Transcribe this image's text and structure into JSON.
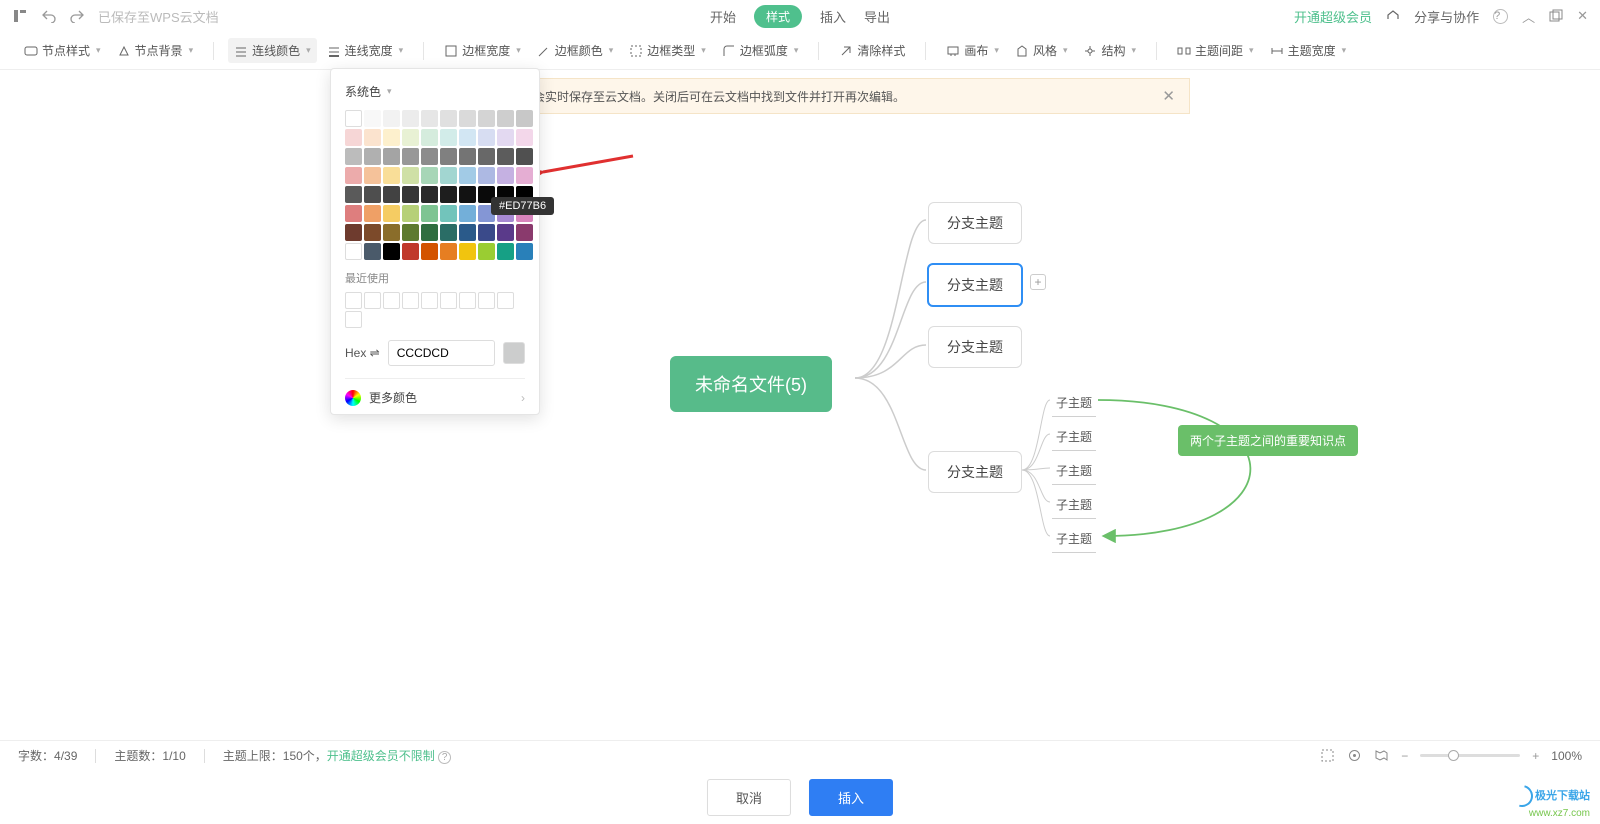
{
  "topbar": {
    "save_status": "已保存至WPS云文档",
    "tabs": {
      "start": "开始",
      "style": "样式",
      "insert": "插入",
      "export": "导出"
    },
    "vip": "开通超级会员",
    "share": "分享与协作"
  },
  "toolbar": {
    "node_style": "节点样式",
    "node_bg": "节点背景",
    "line_color": "连线颜色",
    "line_width": "连线宽度",
    "border_width": "边框宽度",
    "border_color": "边框颜色",
    "border_type": "边框类型",
    "border_radius": "边框弧度",
    "clear": "清除样式",
    "canvas": "画布",
    "theme": "风格",
    "structure": "结构",
    "topic_gap": "主题间距",
    "topic_width": "主题宽度"
  },
  "notify": {
    "text": "时需保持联网，内容会实时保存至云文档。关闭后可在云文档中找到文件并打开再次编辑。"
  },
  "color_picker": {
    "header": "系统色",
    "tooltip": "#ED77B6",
    "recent_label": "最近使用",
    "hex_label": "Hex ⇌",
    "hex_value": "CCCDCD",
    "more": "更多颜色",
    "rows": [
      [
        "#ffffff",
        "#f8f8f8",
        "#f2f2f2",
        "#ececec",
        "#e6e6e6",
        "#e0e0e0",
        "#dadada",
        "#d4d4d4",
        "#cecece",
        "#c8c8c8"
      ],
      [
        "#f6d6d6",
        "#fbe3ce",
        "#fdf0cd",
        "#e8f1d4",
        "#d5ecdd",
        "#d2ece9",
        "#d2e6f3",
        "#d7ddf2",
        "#e3d9f1",
        "#f3d7ea"
      ],
      [
        "#bcbcbc",
        "#b0b0b0",
        "#a4a4a4",
        "#989898",
        "#8c8c8c",
        "#808080",
        "#747474",
        "#686868",
        "#5c5c5c",
        "#505050"
      ],
      [
        "#ecabab",
        "#f5c29a",
        "#f9de98",
        "#cfe0a6",
        "#a7d6b7",
        "#a2d6d1",
        "#a2cbe6",
        "#adb9e3",
        "#c5b1e2",
        "#e5aed3"
      ],
      [
        "#5a5a5a",
        "#4e4e4e",
        "#424242",
        "#363636",
        "#2a2a2a",
        "#1e1e1e",
        "#121212",
        "#0a0a0a",
        "#050505",
        "#000000"
      ],
      [
        "#de7e7e",
        "#efa066",
        "#f5cc63",
        "#b6d078",
        "#7ec492",
        "#72c4bb",
        "#73afd9",
        "#8496d5",
        "#a789d3",
        "#d885bd"
      ],
      [
        "#6e3b2e",
        "#7c4a2a",
        "#8a6d2a",
        "#5d7a2f",
        "#2f6d3f",
        "#2a6d66",
        "#2a5a8a",
        "#3a4a8a",
        "#5a3a8a",
        "#8a3a6d"
      ],
      [
        "#ffffff",
        "#4a5a6a",
        "#000000",
        "#c0392b",
        "#d35400",
        "#e67e22",
        "#f1c40f",
        "#9acd32",
        "#16a085",
        "#2980b9"
      ]
    ]
  },
  "mindmap": {
    "root": "未命名文件(5)",
    "branches": [
      "分支主题",
      "分支主题",
      "分支主题",
      "分支主题"
    ],
    "subs": [
      "子主题",
      "子主题",
      "子主题",
      "子主题",
      "子主题"
    ],
    "callout": "两个子主题之间的重要知识点"
  },
  "statusbar": {
    "chars_label": "字数：",
    "chars_value": "4/39",
    "topics_label": "主题数：",
    "topics_value": "1/10",
    "limit_label": "主题上限：",
    "limit_value": "150个，",
    "unlimited": "开通超级会员不限制",
    "zoom": "100%"
  },
  "actions": {
    "cancel": "取消",
    "insert": "插入"
  },
  "watermark": {
    "name": "极光下载站",
    "url": "www.xz7.com"
  }
}
